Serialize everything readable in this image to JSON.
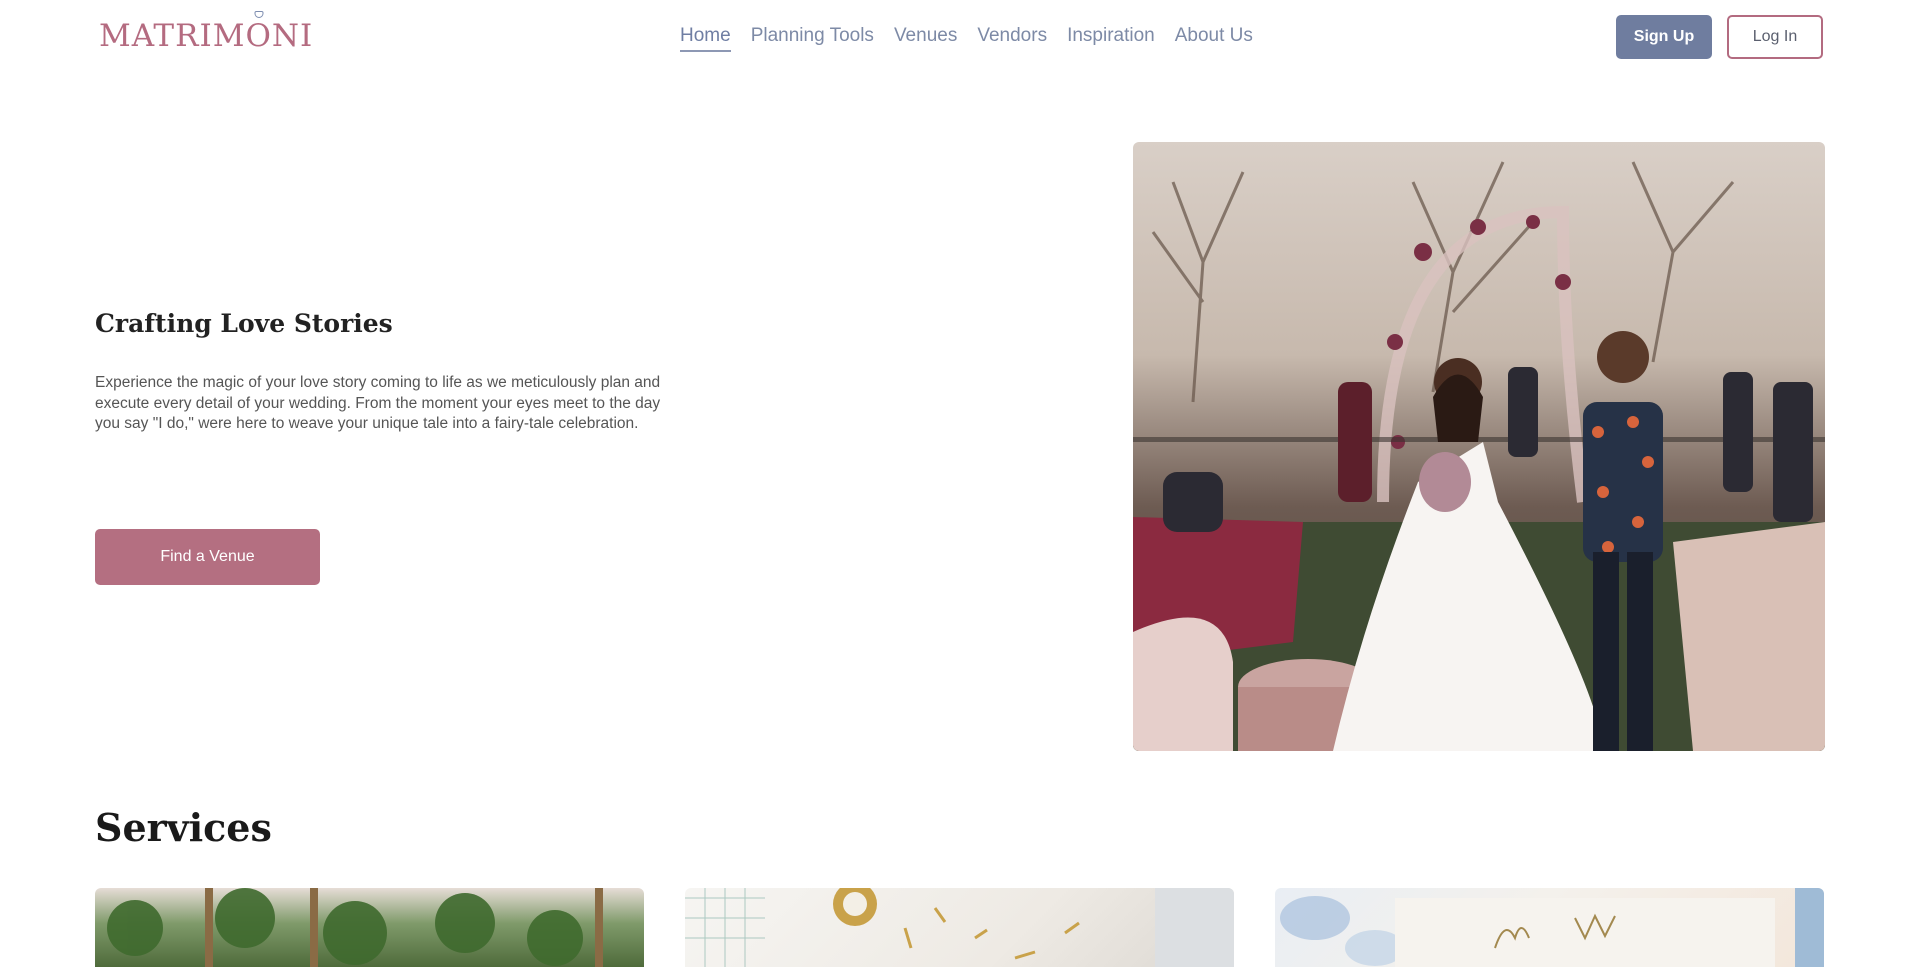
{
  "brand": {
    "logo_pre": "MATRIM",
    "logo_ring": "O",
    "logo_post": "NI"
  },
  "nav": {
    "links": [
      {
        "label": "Home",
        "active": true
      },
      {
        "label": "Planning Tools",
        "active": false
      },
      {
        "label": "Venues",
        "active": false
      },
      {
        "label": "Vendors",
        "active": false
      },
      {
        "label": "Inspiration",
        "active": false
      },
      {
        "label": "About Us",
        "active": false
      }
    ],
    "signup_label": "Sign Up",
    "login_label": "Log In"
  },
  "hero": {
    "title": "Crafting Love Stories",
    "description": "Experience the magic of your love story coming to life as we meticulously plan and execute every detail of your wedding. From the moment your eyes meet to the day you say \"I do,\" were here to weave your unique tale into a fairy-tale celebration.",
    "cta_label": "Find a Venue"
  },
  "services": {
    "title": "Services",
    "card_count_visible": 3
  },
  "colors": {
    "brand_rose": "#b46f81",
    "nav_slate": "#6f7d9f",
    "nav_text": "#7d8aa6"
  },
  "images": {
    "hero": "wedding-couple-photo",
    "service_1": "floral-garden-photo",
    "service_2": "planning-desk-photo",
    "service_3": "wedding-stationery-photo"
  }
}
